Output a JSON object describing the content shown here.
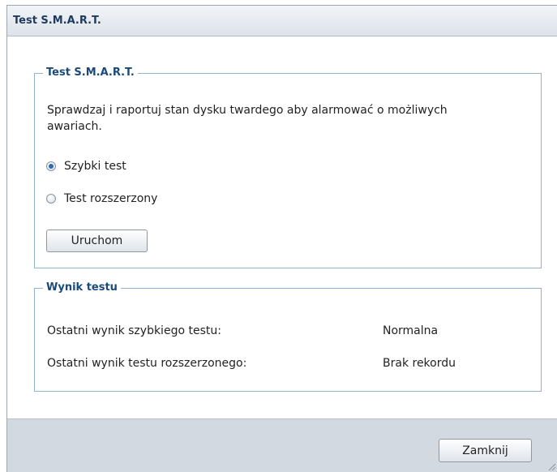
{
  "window": {
    "title": "Test S.M.A.R.T."
  },
  "smart_test": {
    "legend": "Test S.M.A.R.T.",
    "description": "Sprawdzaj i raportuj stan dysku twardego aby alarmować o możliwych awariach.",
    "options": [
      {
        "label": "Szybki test",
        "checked": true
      },
      {
        "label": "Test rozszerzony",
        "checked": false
      }
    ],
    "run_label": "Uruchom"
  },
  "test_result": {
    "legend": "Wynik testu",
    "rows": [
      {
        "label": "Ostatni wynik szybkiego testu:",
        "value": "Normalna"
      },
      {
        "label": "Ostatni wynik testu rozszerzonego:",
        "value": "Brak rekordu"
      }
    ]
  },
  "footer": {
    "close_label": "Zamknij"
  },
  "colors": {
    "legend_text": "#1a4a7a",
    "border": "#8fb3d1",
    "footer_bg": "#d3d9e0",
    "radio_selected": "#2b6cb0"
  }
}
